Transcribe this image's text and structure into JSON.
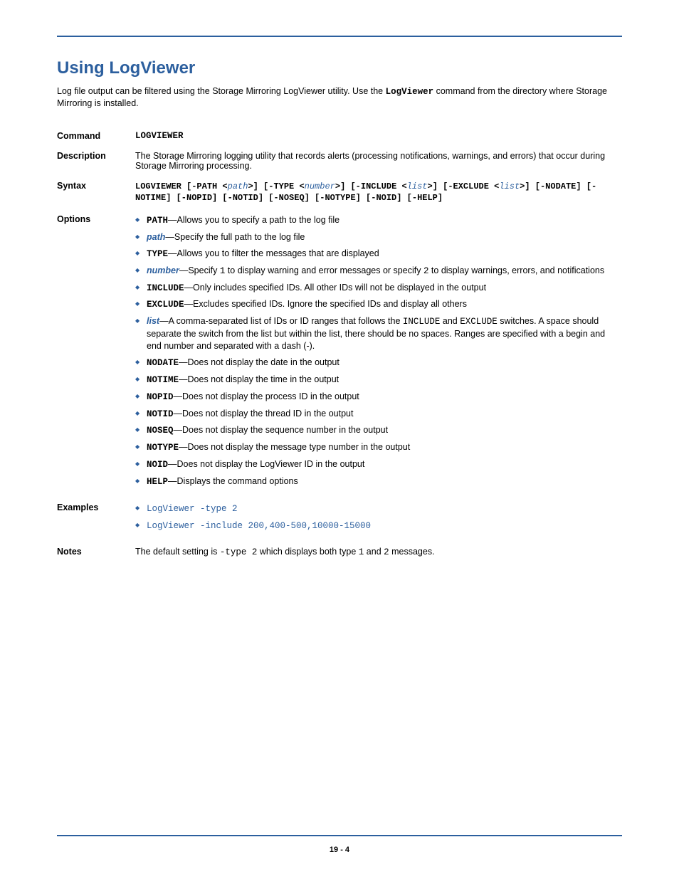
{
  "heading": "Using LogViewer",
  "intro_part1": "Log file output can be filtered using the Storage Mirroring LogViewer utility. Use the ",
  "intro_code": "LogViewer",
  "intro_part2": " command from the directory where Storage Mirroring is installed.",
  "labels": {
    "command": "Command",
    "description": "Description",
    "syntax": "Syntax",
    "options": "Options",
    "examples": "Examples",
    "notes": "Notes"
  },
  "command_value": "LOGVIEWER",
  "description_text": "The Storage Mirroring logging utility that records alerts (processing notifications, warnings, and errors) that occur during Storage Mirroring processing.",
  "syntax": {
    "prefix": "LOGVIEWER [-PATH <",
    "p1": "path",
    "m1": ">] [-TYPE <",
    "p2": "number",
    "m2": ">] [-INCLUDE <",
    "p3": "list",
    "m3": ">] [-EXCLUDE <",
    "p4": "list",
    "m4": ">] [-NODATE] [-NOTIME] [-NOPID] [-NOTID] [-NOSEQ] [-NOTYPE] [-NOID] [-HELP]"
  },
  "options": [
    {
      "kw": "PATH",
      "kw_mono": true,
      "text": "—Allows you to specify a path to the log file"
    },
    {
      "kw": "path",
      "kw_mono": false,
      "text": "—Specify the full path to the log file"
    },
    {
      "kw": "TYPE",
      "kw_mono": true,
      "text": "—Allows you to filter the messages that are displayed"
    },
    {
      "kw": "number",
      "kw_mono": false,
      "text_pre": "—Specify ",
      "code1": "1",
      "text_mid": " to display warning and error messages or specify ",
      "code2": "2",
      "text_post": " to display warnings, errors, and notifications"
    },
    {
      "kw": "INCLUDE",
      "kw_mono": true,
      "text": "—Only includes specified IDs. All other IDs will not be displayed in the output"
    },
    {
      "kw": "EXCLUDE",
      "kw_mono": true,
      "text": "—Excludes specified IDs. Ignore the specified IDs and display all others"
    },
    {
      "kw": "list",
      "kw_mono": false,
      "text_pre": "—A comma-separated list of IDs or ID ranges that follows the ",
      "code1": "INCLUDE",
      "text_mid": " and ",
      "code2": "EXCLUDE",
      "text_post": " switches. A space should separate the switch from the list but within the list, there should be no spaces. Ranges are specified with a begin and end number and separated with a dash (-)."
    },
    {
      "kw": "NODATE",
      "kw_mono": true,
      "text": "—Does not display the date in the output"
    },
    {
      "kw": "NOTIME",
      "kw_mono": true,
      "text": "—Does not display the time in the output"
    },
    {
      "kw": "NOPID",
      "kw_mono": true,
      "text": "—Does not display the process ID in the output"
    },
    {
      "kw": "NOTID",
      "kw_mono": true,
      "text": "—Does not display the thread ID in the output"
    },
    {
      "kw": "NOSEQ",
      "kw_mono": true,
      "text": "—Does not display the sequence number in the output"
    },
    {
      "kw": "NOTYPE",
      "kw_mono": true,
      "text": "—Does not display the message type number in the output"
    },
    {
      "kw": "NOID",
      "kw_mono": true,
      "text": "—Does not display the LogViewer ID in the output"
    },
    {
      "kw": "HELP",
      "kw_mono": true,
      "text": "—Displays the command options"
    }
  ],
  "examples": [
    "LogViewer -type 2",
    "LogViewer -include 200,400-500,10000-15000"
  ],
  "notes": {
    "pre": "The default setting is ",
    "code1": "-type 2",
    "mid": " which displays both type ",
    "code2": "1",
    "mid2": " and ",
    "code3": "2",
    "post": " messages."
  },
  "page_number": "19 - 4"
}
